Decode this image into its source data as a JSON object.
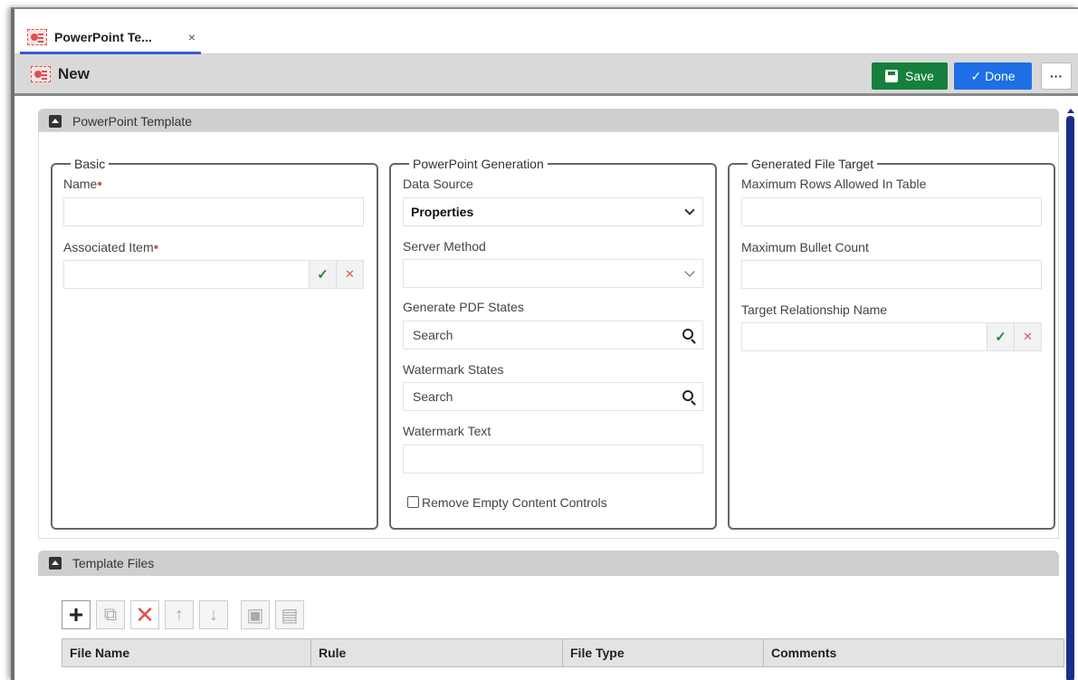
{
  "tab": {
    "title": "PowerPoint Te...",
    "close": "×"
  },
  "toolbar": {
    "title": "New",
    "save_label": "Save",
    "done_label": "✓ Done",
    "more_label": "···"
  },
  "section1": {
    "title": "PowerPoint Template"
  },
  "basic": {
    "legend": "Basic",
    "name_label": "Name",
    "assoc_label": "Associated Item",
    "required": "•"
  },
  "generation": {
    "legend": "PowerPoint Generation",
    "data_source_label": "Data Source",
    "data_source_value": "Properties",
    "server_method_label": "Server Method",
    "pdf_states_label": "Generate PDF States",
    "pdf_states_placeholder": "Search",
    "watermark_states_label": "Watermark States",
    "watermark_states_placeholder": "Search",
    "watermark_text_label": "Watermark Text",
    "remove_empty_label": "Remove Empty Content Controls"
  },
  "target": {
    "legend": "Generated File Target",
    "max_rows_label": "Maximum Rows Allowed In Table",
    "max_bullet_label": "Maximum Bullet Count",
    "target_rel_label": "Target Relationship Name"
  },
  "actions": {
    "check": "✓",
    "clear": "✕"
  },
  "section2": {
    "title": "Template Files"
  },
  "tf_toolbar": {
    "plus": "+",
    "edit": "⧉",
    "delete": "✕",
    "up": "↑",
    "down": "↓",
    "excel": "▣",
    "pdf": "▤"
  },
  "grid": {
    "columns": [
      "File Name",
      "Rule",
      "File Type",
      "Comments"
    ]
  },
  "colors": {
    "save": "#15803d",
    "done": "#1e6fe6",
    "accent": "#3a5bd6",
    "required": "#d9534f"
  }
}
